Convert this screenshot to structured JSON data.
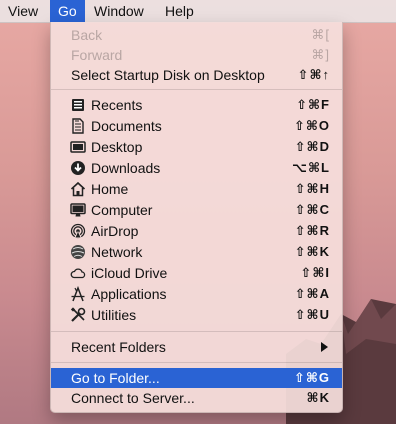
{
  "menubar": {
    "items": [
      {
        "label": "View"
      },
      {
        "label": "Go"
      },
      {
        "label": "Window"
      },
      {
        "label": "Help"
      }
    ]
  },
  "go_menu": {
    "back": {
      "label": "Back",
      "shortcut": "⌘["
    },
    "forward": {
      "label": "Forward",
      "shortcut": "⌘]"
    },
    "startup_disk": {
      "label": "Select Startup Disk on Desktop",
      "shortcut": "⇧⌘↑"
    },
    "places": [
      {
        "label": "Recents",
        "shortcut": "⇧⌘F",
        "icon": "recents-icon"
      },
      {
        "label": "Documents",
        "shortcut": "⇧⌘O",
        "icon": "documents-icon"
      },
      {
        "label": "Desktop",
        "shortcut": "⇧⌘D",
        "icon": "desktop-icon"
      },
      {
        "label": "Downloads",
        "shortcut": "⌥⌘L",
        "icon": "downloads-icon"
      },
      {
        "label": "Home",
        "shortcut": "⇧⌘H",
        "icon": "home-icon"
      },
      {
        "label": "Computer",
        "shortcut": "⇧⌘C",
        "icon": "computer-icon"
      },
      {
        "label": "AirDrop",
        "shortcut": "⇧⌘R",
        "icon": "airdrop-icon"
      },
      {
        "label": "Network",
        "shortcut": "⇧⌘K",
        "icon": "network-icon"
      },
      {
        "label": "iCloud Drive",
        "shortcut": "⇧⌘I",
        "icon": "icloud-icon"
      },
      {
        "label": "Applications",
        "shortcut": "⇧⌘A",
        "icon": "applications-icon"
      },
      {
        "label": "Utilities",
        "shortcut": "⇧⌘U",
        "icon": "utilities-icon"
      }
    ],
    "recent_folders": {
      "label": "Recent Folders"
    },
    "go_to_folder": {
      "label": "Go to Folder...",
      "shortcut": "⇧⌘G"
    },
    "connect_server": {
      "label": "Connect to Server...",
      "shortcut": "⌘K"
    }
  },
  "colors": {
    "highlight": "#2a63d4",
    "menu_bg": "#f5dedc",
    "disabled_text": "#b9a6a4"
  }
}
